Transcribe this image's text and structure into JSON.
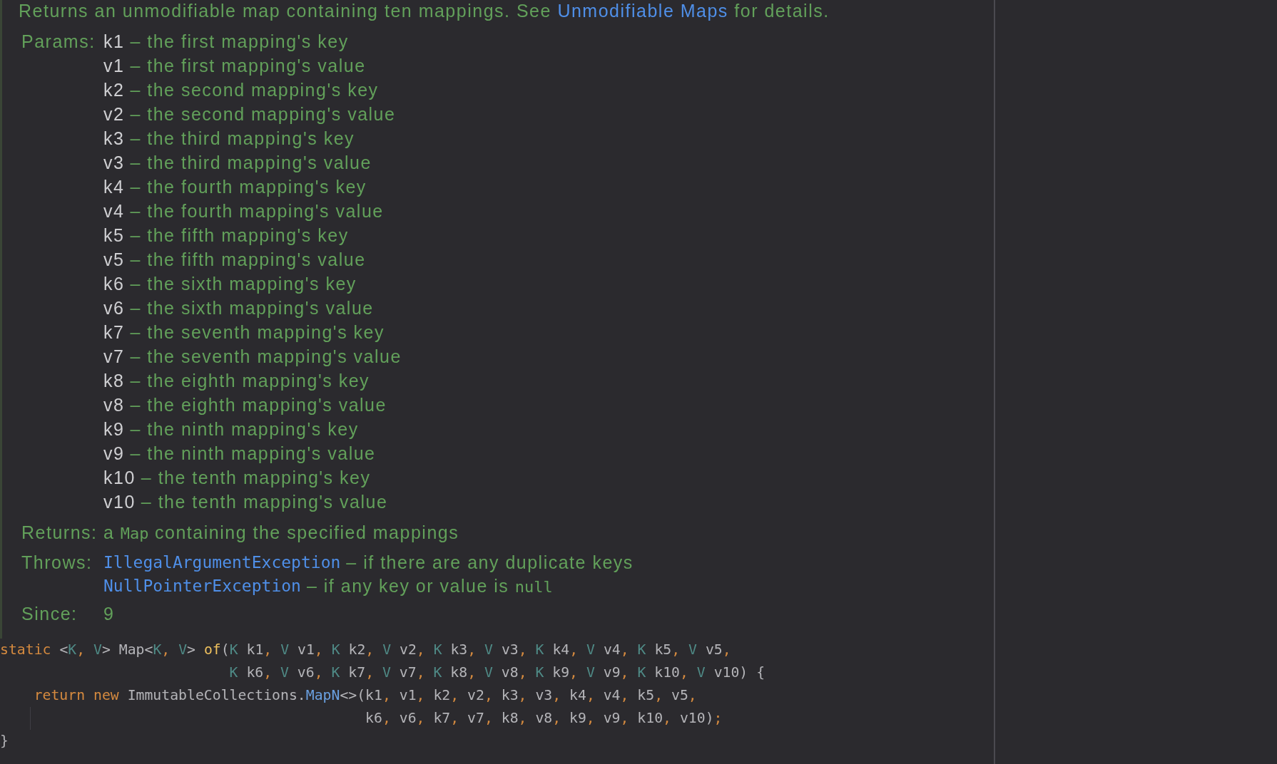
{
  "description": {
    "text": "Returns an unmodifiable map containing ten mappings. See ",
    "link": "Unmodifiable Maps",
    "text_after": " for details."
  },
  "params": {
    "label": "Params:",
    "items": [
      {
        "name": "k1",
        "description": "– the first mapping's key"
      },
      {
        "name": "v1",
        "description": "– the first mapping's value"
      },
      {
        "name": "k2",
        "description": "– the second mapping's key"
      },
      {
        "name": "v2",
        "description": "– the second mapping's value"
      },
      {
        "name": "k3",
        "description": "– the third mapping's key"
      },
      {
        "name": "v3",
        "description": "– the third mapping's value"
      },
      {
        "name": "k4",
        "description": "– the fourth mapping's key"
      },
      {
        "name": "v4",
        "description": "– the fourth mapping's value"
      },
      {
        "name": "k5",
        "description": "– the fifth mapping's key"
      },
      {
        "name": "v5",
        "description": "– the fifth mapping's value"
      },
      {
        "name": "k6",
        "description": "– the sixth mapping's key"
      },
      {
        "name": "v6",
        "description": "– the sixth mapping's value"
      },
      {
        "name": "k7",
        "description": "– the seventh mapping's key"
      },
      {
        "name": "v7",
        "description": "– the seventh mapping's value"
      },
      {
        "name": "k8",
        "description": "– the eighth mapping's key"
      },
      {
        "name": "v8",
        "description": "– the eighth mapping's value"
      },
      {
        "name": "k9",
        "description": "– the ninth mapping's key"
      },
      {
        "name": "v9",
        "description": "– the ninth mapping's value"
      },
      {
        "name": "k10",
        "description": "– the tenth mapping's key"
      },
      {
        "name": "v10",
        "description": "– the tenth mapping's value"
      }
    ]
  },
  "returns": {
    "label": "Returns:",
    "parts": [
      {
        "text": "a ",
        "kind": "text"
      },
      {
        "text": "Map",
        "kind": "code"
      },
      {
        "text": " containing the specified mappings",
        "kind": "text"
      }
    ]
  },
  "throws": {
    "label": "Throws:",
    "items": [
      {
        "exception": "IllegalArgumentException",
        "parts": [
          {
            "text": "– if there are any duplicate keys",
            "kind": "text"
          }
        ]
      },
      {
        "exception": "NullPointerException",
        "parts": [
          {
            "text": "– if any key or value is ",
            "kind": "text"
          },
          {
            "text": "null",
            "kind": "code"
          }
        ]
      }
    ]
  },
  "since": {
    "label": "Since:",
    "value": "9"
  },
  "code": [
    {
      "indent_guide": false,
      "tokens": [
        {
          "text": "static",
          "kind": "keyword"
        },
        {
          "text": " <",
          "kind": "plain"
        },
        {
          "text": "K",
          "kind": "type_param"
        },
        {
          "text": ", ",
          "kind": "punct"
        },
        {
          "text": "V",
          "kind": "type_param"
        },
        {
          "text": "> Map<",
          "kind": "plain"
        },
        {
          "text": "K",
          "kind": "type_param"
        },
        {
          "text": ", ",
          "kind": "punct"
        },
        {
          "text": "V",
          "kind": "type_param"
        },
        {
          "text": "> ",
          "kind": "plain"
        },
        {
          "text": "of",
          "kind": "method"
        },
        {
          "text": "(",
          "kind": "plain"
        },
        {
          "text": "K",
          "kind": "type_param"
        },
        {
          "text": " k1",
          "kind": "plain"
        },
        {
          "text": ", ",
          "kind": "punct"
        },
        {
          "text": "V",
          "kind": "type_param"
        },
        {
          "text": " v1",
          "kind": "plain"
        },
        {
          "text": ", ",
          "kind": "punct"
        },
        {
          "text": "K",
          "kind": "type_param"
        },
        {
          "text": " k2",
          "kind": "plain"
        },
        {
          "text": ", ",
          "kind": "punct"
        },
        {
          "text": "V",
          "kind": "type_param"
        },
        {
          "text": " v2",
          "kind": "plain"
        },
        {
          "text": ", ",
          "kind": "punct"
        },
        {
          "text": "K",
          "kind": "type_param"
        },
        {
          "text": " k3",
          "kind": "plain"
        },
        {
          "text": ", ",
          "kind": "punct"
        },
        {
          "text": "V",
          "kind": "type_param"
        },
        {
          "text": " v3",
          "kind": "plain"
        },
        {
          "text": ", ",
          "kind": "punct"
        },
        {
          "text": "K",
          "kind": "type_param"
        },
        {
          "text": " k4",
          "kind": "plain"
        },
        {
          "text": ", ",
          "kind": "punct"
        },
        {
          "text": "V",
          "kind": "type_param"
        },
        {
          "text": " v4",
          "kind": "plain"
        },
        {
          "text": ", ",
          "kind": "punct"
        },
        {
          "text": "K",
          "kind": "type_param"
        },
        {
          "text": " k5",
          "kind": "plain"
        },
        {
          "text": ", ",
          "kind": "punct"
        },
        {
          "text": "V",
          "kind": "type_param"
        },
        {
          "text": " v5",
          "kind": "plain"
        },
        {
          "text": ",",
          "kind": "punct"
        }
      ]
    },
    {
      "indent_guide": false,
      "tokens": [
        {
          "text": "                           K",
          "kind": "type_param"
        },
        {
          "text": " k6",
          "kind": "plain"
        },
        {
          "text": ", ",
          "kind": "punct"
        },
        {
          "text": "V",
          "kind": "type_param"
        },
        {
          "text": " v6",
          "kind": "plain"
        },
        {
          "text": ", ",
          "kind": "punct"
        },
        {
          "text": "K",
          "kind": "type_param"
        },
        {
          "text": " k7",
          "kind": "plain"
        },
        {
          "text": ", ",
          "kind": "punct"
        },
        {
          "text": "V",
          "kind": "type_param"
        },
        {
          "text": " v7",
          "kind": "plain"
        },
        {
          "text": ", ",
          "kind": "punct"
        },
        {
          "text": "K",
          "kind": "type_param"
        },
        {
          "text": " k8",
          "kind": "plain"
        },
        {
          "text": ", ",
          "kind": "punct"
        },
        {
          "text": "V",
          "kind": "type_param"
        },
        {
          "text": " v8",
          "kind": "plain"
        },
        {
          "text": ", ",
          "kind": "punct"
        },
        {
          "text": "K",
          "kind": "type_param"
        },
        {
          "text": " k9",
          "kind": "plain"
        },
        {
          "text": ", ",
          "kind": "punct"
        },
        {
          "text": "V",
          "kind": "type_param"
        },
        {
          "text": " v9",
          "kind": "plain"
        },
        {
          "text": ", ",
          "kind": "punct"
        },
        {
          "text": "K",
          "kind": "type_param"
        },
        {
          "text": " k10",
          "kind": "plain"
        },
        {
          "text": ", ",
          "kind": "punct"
        },
        {
          "text": "V",
          "kind": "type_param"
        },
        {
          "text": " v10) {",
          "kind": "plain"
        }
      ]
    },
    {
      "indent_guide": false,
      "tokens": [
        {
          "text": "    return new",
          "kind": "keyword"
        },
        {
          "text": " ImmutableCollections.",
          "kind": "plain"
        },
        {
          "text": "MapN",
          "kind": "class_ref"
        },
        {
          "text": "<>(k1",
          "kind": "plain"
        },
        {
          "text": ",",
          "kind": "punct"
        },
        {
          "text": " v1",
          "kind": "plain"
        },
        {
          "text": ",",
          "kind": "punct"
        },
        {
          "text": " k2",
          "kind": "plain"
        },
        {
          "text": ",",
          "kind": "punct"
        },
        {
          "text": " v2",
          "kind": "plain"
        },
        {
          "text": ",",
          "kind": "punct"
        },
        {
          "text": " k3",
          "kind": "plain"
        },
        {
          "text": ",",
          "kind": "punct"
        },
        {
          "text": " v3",
          "kind": "plain"
        },
        {
          "text": ",",
          "kind": "punct"
        },
        {
          "text": " k4",
          "kind": "plain"
        },
        {
          "text": ",",
          "kind": "punct"
        },
        {
          "text": " v4",
          "kind": "plain"
        },
        {
          "text": ",",
          "kind": "punct"
        },
        {
          "text": " k5",
          "kind": "plain"
        },
        {
          "text": ",",
          "kind": "punct"
        },
        {
          "text": " v5",
          "kind": "plain"
        },
        {
          "text": ",",
          "kind": "punct"
        }
      ]
    },
    {
      "indent_guide": true,
      "tokens": [
        {
          "text": "                                           k6",
          "kind": "plain"
        },
        {
          "text": ",",
          "kind": "punct"
        },
        {
          "text": " v6",
          "kind": "plain"
        },
        {
          "text": ",",
          "kind": "punct"
        },
        {
          "text": " k7",
          "kind": "plain"
        },
        {
          "text": ",",
          "kind": "punct"
        },
        {
          "text": " v7",
          "kind": "plain"
        },
        {
          "text": ",",
          "kind": "punct"
        },
        {
          "text": " k8",
          "kind": "plain"
        },
        {
          "text": ",",
          "kind": "punct"
        },
        {
          "text": " v8",
          "kind": "plain"
        },
        {
          "text": ",",
          "kind": "punct"
        },
        {
          "text": " k9",
          "kind": "plain"
        },
        {
          "text": ",",
          "kind": "punct"
        },
        {
          "text": " v9",
          "kind": "plain"
        },
        {
          "text": ",",
          "kind": "punct"
        },
        {
          "text": " k10",
          "kind": "plain"
        },
        {
          "text": ",",
          "kind": "punct"
        },
        {
          "text": " v10)",
          "kind": "plain"
        },
        {
          "text": ";",
          "kind": "punct"
        }
      ]
    },
    {
      "indent_guide": false,
      "tokens": [
        {
          "text": "}",
          "kind": "plain"
        }
      ]
    }
  ]
}
